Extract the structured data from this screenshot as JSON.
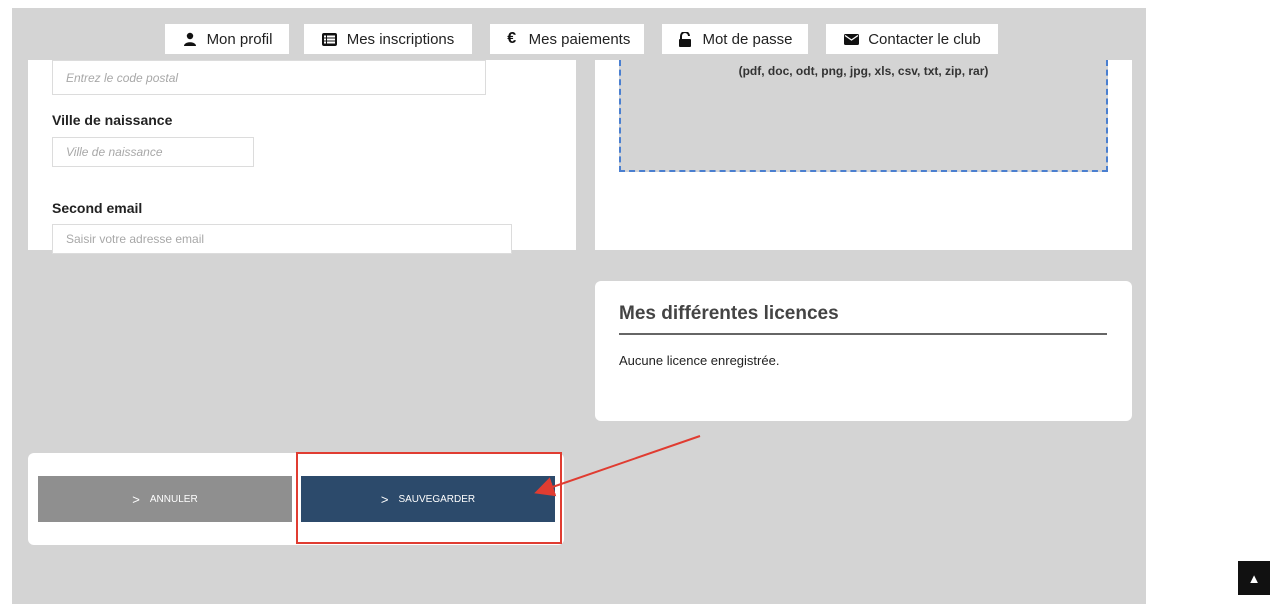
{
  "nav": {
    "tabs": [
      {
        "label": "Mon profil",
        "icon": "user-icon"
      },
      {
        "label": "Mes inscriptions",
        "icon": "list-icon"
      },
      {
        "label": "Mes paiements",
        "icon": "euro-icon"
      },
      {
        "label": "Mot de passe",
        "icon": "unlock-icon"
      },
      {
        "label": "Contacter le club",
        "icon": "envelope-icon"
      }
    ]
  },
  "form": {
    "postal_code_placeholder": "Entrez le code postal",
    "birth_city_label": "Ville de naissance",
    "birth_city_placeholder": "Ville de naissance",
    "second_email_label": "Second email",
    "second_email_placeholder": "Saisir votre adresse email"
  },
  "upload": {
    "formats": "(pdf, doc, odt, png, jpg, xls, csv, txt, zip, rar)"
  },
  "licences": {
    "title": "Mes différentes licences",
    "empty_text": "Aucune licence enregistrée."
  },
  "actions": {
    "cancel_label": "ANNULER",
    "save_label": "SAUVEGARDER"
  },
  "colors": {
    "cancel_bg": "#8f8f8f",
    "save_bg": "#2c4a6b",
    "highlight": "#e03c31",
    "dropzone_border": "#4a7fd0"
  }
}
